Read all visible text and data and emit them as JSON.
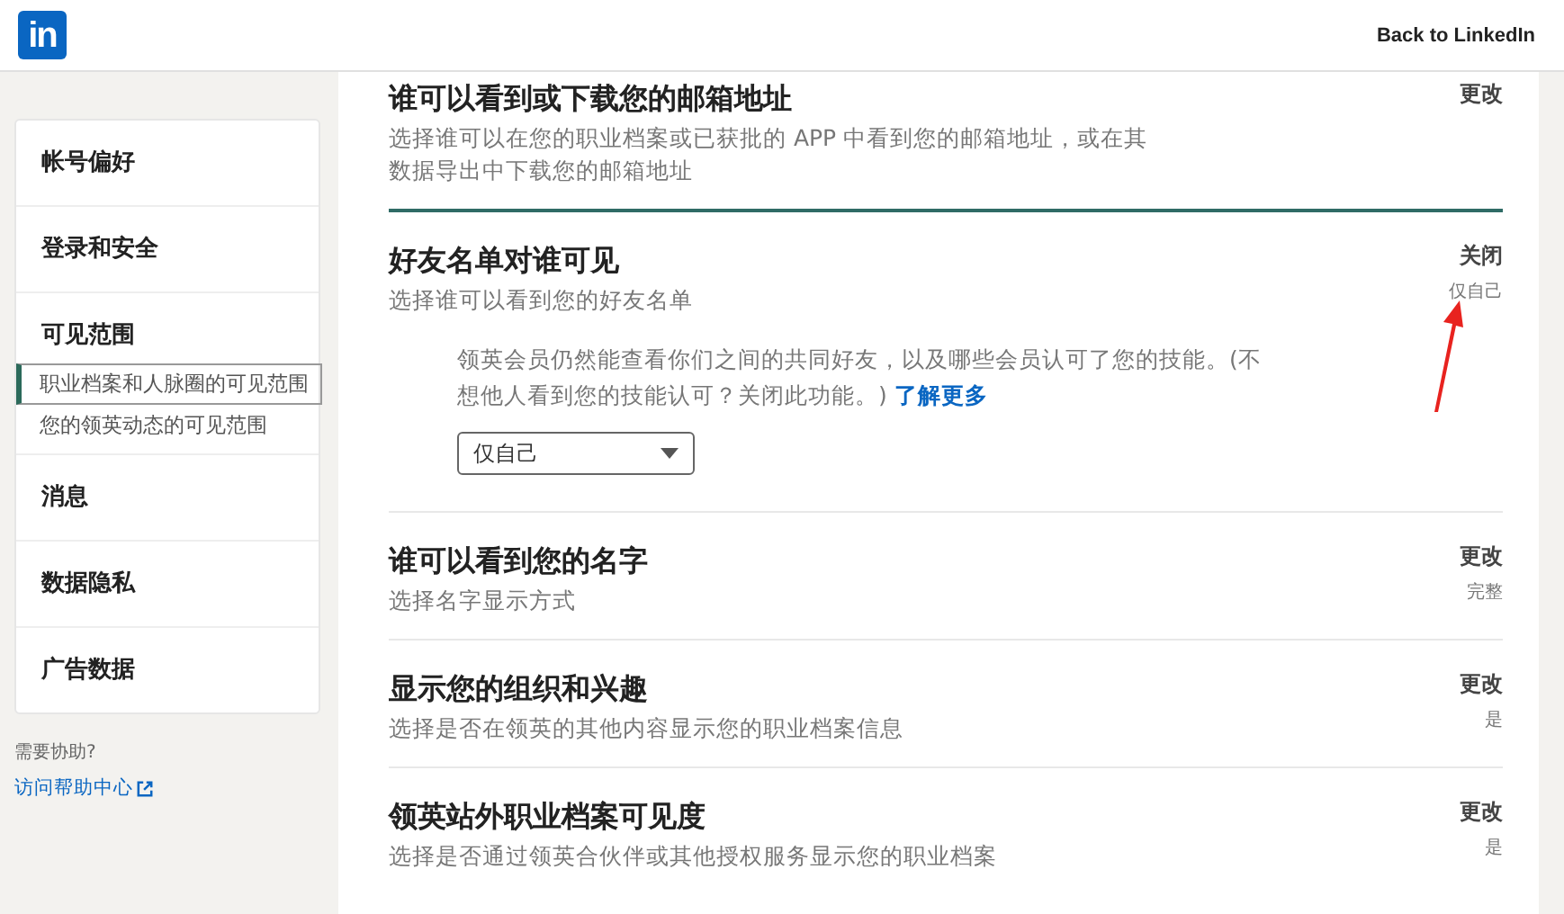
{
  "header": {
    "logo": "in",
    "back_link": "Back to LinkedIn"
  },
  "sidebar": {
    "sections": [
      {
        "label": "帐号偏好"
      },
      {
        "label": "登录和安全"
      },
      {
        "label": "可见范围",
        "items": [
          {
            "label": "职业档案和人脉圈的可见范围",
            "selected": true
          },
          {
            "label": "您的领英动态的可见范围",
            "selected": false
          }
        ]
      },
      {
        "label": "消息"
      },
      {
        "label": "数据隐私"
      },
      {
        "label": "广告数据"
      }
    ],
    "help": {
      "label": "需要协助?",
      "link": "访问帮助中心"
    }
  },
  "settings": [
    {
      "title": "谁可以看到或下载您的邮箱地址",
      "description": "选择谁可以在您的职业档案或已获批的 APP 中看到您的邮箱地址，或在其数据导出中下载您的邮箱地址",
      "action": "更改",
      "expanded": false
    },
    {
      "title": "好友名单对谁可见",
      "description": "选择谁可以看到您的好友名单",
      "action": "关闭",
      "value": "仅自己",
      "expanded": true,
      "note": "领英会员仍然能查看你们之间的共同好友，以及哪些会员认可了您的技能。(不想他人看到您的技能认可？关闭此功能。)",
      "note_link": "了解更多",
      "select": "仅自己"
    },
    {
      "title": "谁可以看到您的名字",
      "description": "选择名字显示方式",
      "action": "更改",
      "value": "完整",
      "expanded": false
    },
    {
      "title": "显示您的组织和兴趣",
      "description": "选择是否在领英的其他内容显示您的职业档案信息",
      "action": "更改",
      "value": "是",
      "expanded": false
    },
    {
      "title": "领英站外职业档案可见度",
      "description": "选择是否通过领英合伙伴或其他授权服务显示您的职业档案",
      "action": "更改",
      "value": "是",
      "expanded": false
    }
  ]
}
